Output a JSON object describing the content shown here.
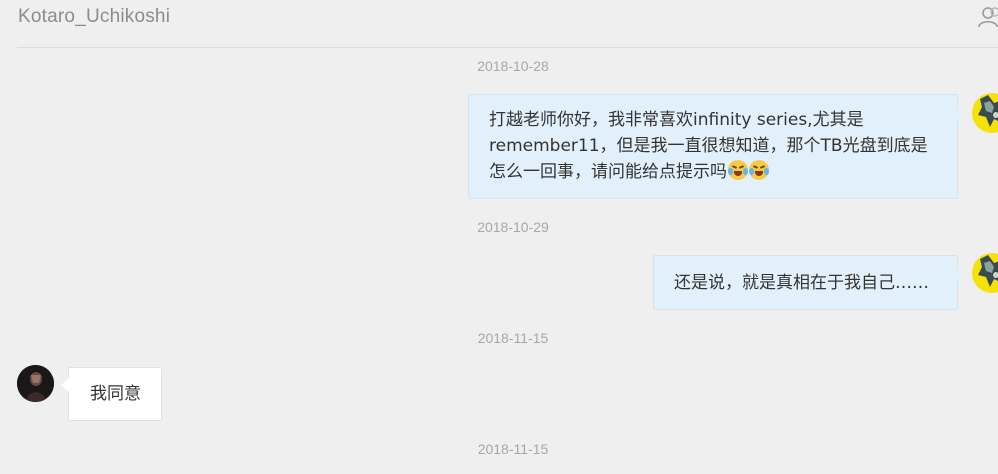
{
  "header": {
    "title": "Kotaro_Uchikoshi",
    "icon": "user-icon"
  },
  "messages": [
    {
      "date": "2018-10-28",
      "side": "me",
      "text": "打越老师你好，我非常喜欢infinity series,尤其是remember11，但是我一直很想知道，那个TB光盘到底是怎么一回事，请问能给点提示吗",
      "emoji": [
        "laugh-cry-emoji",
        "laugh-cry-emoji"
      ]
    },
    {
      "date": "2018-10-29",
      "side": "me",
      "text": "还是说，就是真相在于我自己……"
    },
    {
      "date": "2018-11-15",
      "side": "other",
      "text": "我同意"
    },
    {
      "date": "2018-11-15",
      "side": "me",
      "text": ""
    }
  ],
  "colors": {
    "background": "#efefef",
    "my_bubble": "#e2f0fb",
    "their_bubble": "#ffffff",
    "timestamp": "#a7a7a7",
    "my_avatar": "#f5e20a"
  }
}
